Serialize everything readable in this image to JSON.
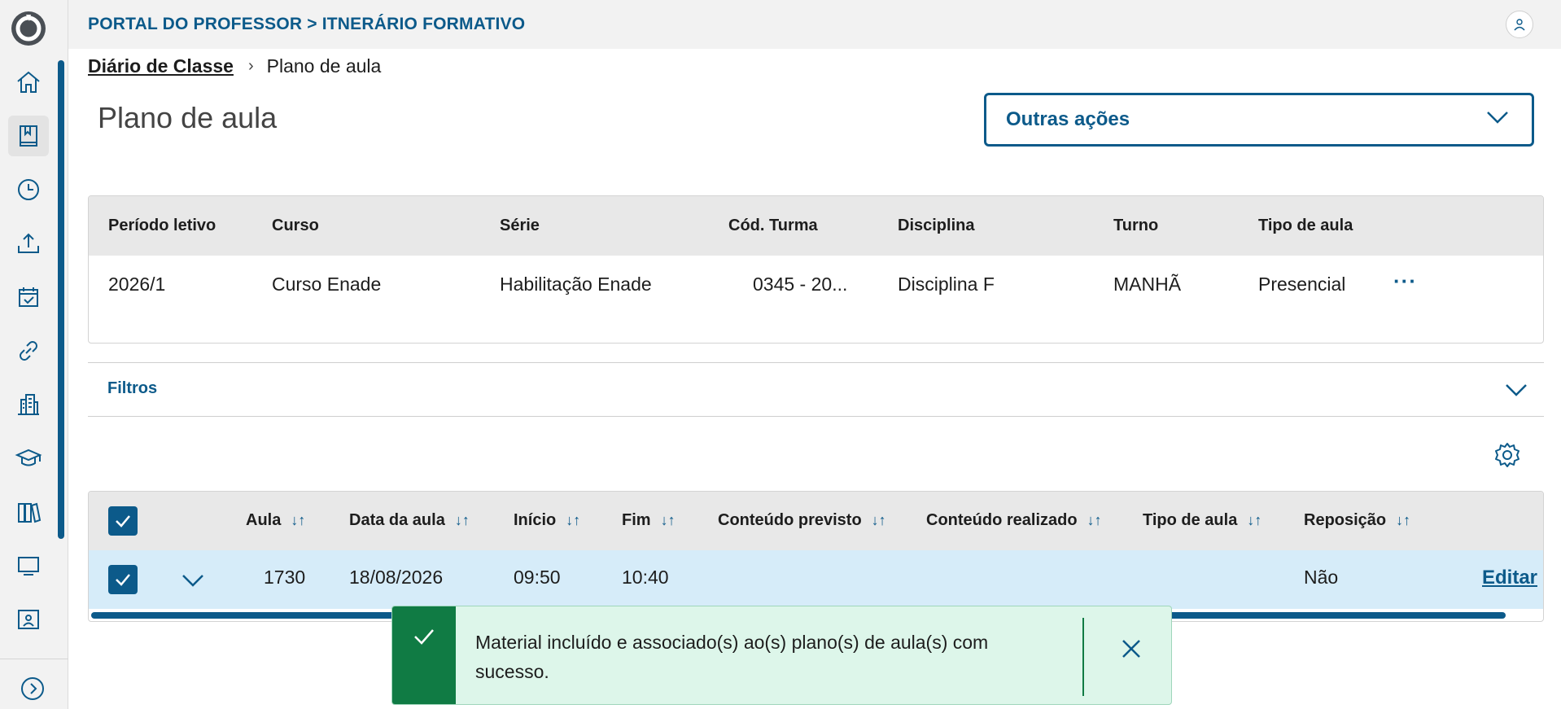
{
  "header": {
    "title": "PORTAL DO PROFESSOR > ITNERÁRIO FORMATIVO"
  },
  "sidebar": {
    "items": [
      {
        "icon": "home-icon"
      },
      {
        "icon": "book-icon",
        "active": true
      },
      {
        "icon": "clock-icon"
      },
      {
        "icon": "upload-icon"
      },
      {
        "icon": "calendar-check-icon"
      },
      {
        "icon": "link-icon"
      },
      {
        "icon": "building-icon"
      },
      {
        "icon": "graduation-cap-icon"
      },
      {
        "icon": "books-icon"
      },
      {
        "icon": "monitor-icon"
      },
      {
        "icon": "classroom-icon"
      }
    ]
  },
  "breadcrumb": {
    "parent": "Diário de Classe",
    "current": "Plano de aula"
  },
  "page": {
    "title": "Plano de aula",
    "other_actions": "Outras ações"
  },
  "info_table": {
    "headers": [
      "Período letivo",
      "Curso",
      "Série",
      "Cód. Turma",
      "Disciplina",
      "Turno",
      "Tipo de aula"
    ],
    "values": [
      "2026/1",
      "Curso Enade",
      "Habilitação Enade",
      "0345 - 20...",
      "Disciplina F",
      "MANHÃ",
      "Presencial"
    ]
  },
  "filters": {
    "label": "Filtros"
  },
  "lessons_table": {
    "headers": [
      "Aula",
      "Data da aula",
      "Início",
      "Fim",
      "Conteúdo previsto",
      "Conteúdo realizado",
      "Tipo de aula",
      "Reposição"
    ],
    "row": {
      "aula": "1730",
      "data": "18/08/2026",
      "inicio": "09:50",
      "fim": "10:40",
      "reposicao": "Não",
      "edit": "Editar"
    }
  },
  "toast": {
    "message": "Material incluído e associado(s) ao(s) plano(s) de aula(s) com sucesso."
  },
  "colors": {
    "primary": "#0c5a8a",
    "success": "#107b44",
    "toast_bg": "#ddf6ea",
    "row_selected": "#d6ecf9"
  }
}
